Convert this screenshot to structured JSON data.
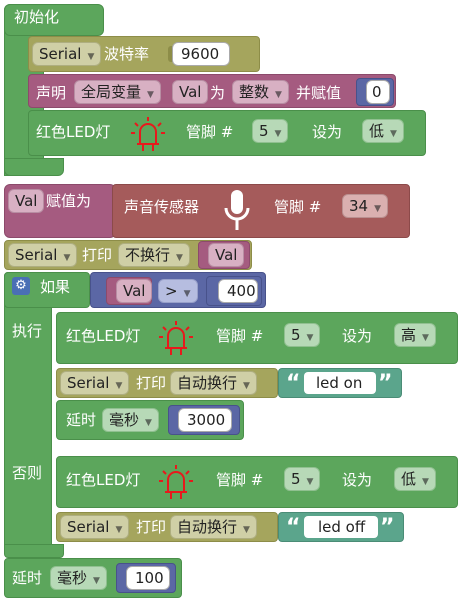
{
  "init": {
    "hat_label": "初始化",
    "serial_baud": {
      "port": "Serial",
      "label": "波特率",
      "value": "9600"
    },
    "declare": {
      "label": "声明",
      "scope": "全局变量",
      "var": "Val",
      "as": "为",
      "type": "整数",
      "assign": "并赋值",
      "value": "0"
    },
    "led1": {
      "label": "红色LED灯",
      "pin_label": "管脚 #",
      "pin": "5",
      "set_label": "设为",
      "state": "低"
    }
  },
  "loop": {
    "assign": {
      "var": "Val",
      "label": "赋值为"
    },
    "sound": {
      "label": "声音传感器",
      "pin_label": "管脚 #",
      "pin": "34"
    },
    "print": {
      "port": "Serial",
      "label": "打印",
      "mode": "不换行",
      "var": "Val"
    },
    "if": {
      "label": "如果",
      "cond": {
        "var": "Val",
        "op": ">",
        "value": "400"
      },
      "do_label": "执行",
      "else_label": "否则",
      "then": {
        "led": {
          "label": "红色LED灯",
          "pin_label": "管脚 #",
          "pin": "5",
          "set_label": "设为",
          "state": "高"
        },
        "print": {
          "port": "Serial",
          "label": "打印",
          "mode": "自动换行",
          "text": "led on"
        },
        "delay": {
          "label": "延时",
          "unit": "毫秒",
          "value": "3000"
        }
      },
      "else": {
        "led": {
          "label": "红色LED灯",
          "pin_label": "管脚 #",
          "pin": "5",
          "set_label": "设为",
          "state": "低"
        },
        "print": {
          "port": "Serial",
          "label": "打印",
          "mode": "自动换行",
          "text": "led off"
        }
      }
    },
    "delay": {
      "label": "延时",
      "unit": "毫秒",
      "value": "100"
    }
  },
  "colors": {
    "setup": "#5ca65c",
    "serial": "#a5a55d",
    "variable": "#a55b80",
    "sensor": "#a55b5b",
    "logic": "#5b67a5",
    "text": "#5ba58c",
    "led_icon": "#e8191c"
  },
  "icons": [
    "led-icon",
    "microphone-icon",
    "gear-icon",
    "dropdown-arrow-icon",
    "quote-open-icon",
    "quote-close-icon"
  ]
}
